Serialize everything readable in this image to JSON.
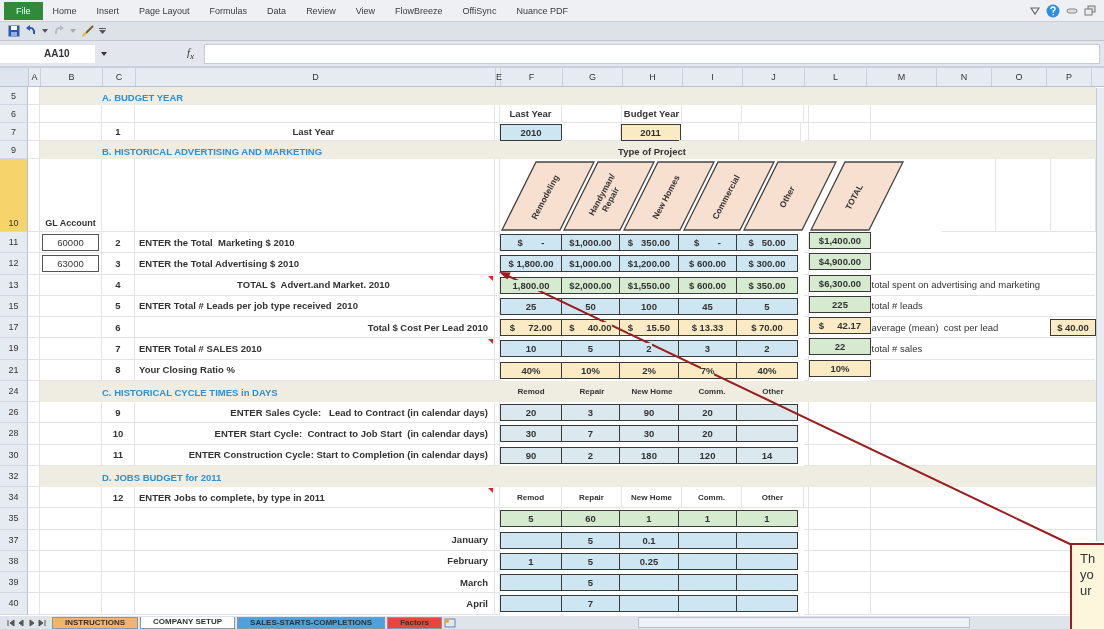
{
  "ribbon": {
    "tabs": [
      {
        "label": "File",
        "selected": true
      },
      {
        "label": "Home",
        "selected": false
      },
      {
        "label": "Insert",
        "selected": false
      },
      {
        "label": "Page Layout",
        "selected": false
      },
      {
        "label": "Formulas",
        "selected": false
      },
      {
        "label": "Data",
        "selected": false
      },
      {
        "label": "Review",
        "selected": false
      },
      {
        "label": "View",
        "selected": false
      },
      {
        "label": "FlowBreeze",
        "selected": false
      },
      {
        "label": "OffiSync",
        "selected": false
      },
      {
        "label": "Nuance PDF",
        "selected": false
      }
    ]
  },
  "formula_bar": {
    "name_box": "AA10",
    "fx": "f$_{x}$"
  },
  "columns": [
    "A",
    "B",
    "C",
    "D",
    "E",
    "F",
    "G",
    "H",
    "I",
    "J",
    "L",
    "M",
    "N",
    "O",
    "P"
  ],
  "rows": [
    {
      "num": "5",
      "kind": "section",
      "title": "A. BUDGET YEAR"
    },
    {
      "num": "6",
      "kind": "entry",
      "cols": [
        {
          "kind": "caption",
          "text": "Last Year"
        },
        {
          "kind": "blank"
        },
        {
          "kind": "caption",
          "text": "Budget Year"
        },
        {
          "kind": "blank"
        },
        {
          "kind": "blank"
        }
      ]
    },
    {
      "num": "7",
      "kind": "total",
      "step": "1",
      "label": "Last Year",
      "cols": [
        {
          "kind": "input",
          "text": "2010"
        },
        {
          "kind": "blank"
        },
        {
          "kind": "result",
          "text": "2011"
        },
        {
          "kind": "blank"
        },
        {
          "kind": "blank"
        }
      ]
    },
    {
      "num": "9",
      "kind": "section",
      "title": "B. HISTORICAL ADVERTISING  AND MARKETING",
      "caption": "Type of Project"
    },
    {
      "num": "10",
      "kind": "diagonal",
      "gl_heading": "GL Account",
      "headers": [
        {
          "lines": [
            "Remodeling"
          ]
        },
        {
          "lines": [
            "Handyman/",
            "Repair"
          ]
        },
        {
          "lines": [
            "New Homes"
          ]
        },
        {
          "lines": [
            "Commercial"
          ]
        },
        {
          "lines": [
            "Other"
          ]
        },
        {
          "lines": [
            "TOTAL"
          ]
        }
      ]
    },
    {
      "num": "11",
      "kind": "entry",
      "gl": "60000",
      "step": "2",
      "label": "ENTER the Total  Marketing $ 2010",
      "cols": [
        {
          "kind": "input",
          "text": "$       -"
        },
        {
          "kind": "input",
          "text": "$1,000.00"
        },
        {
          "kind": "input",
          "text": "$   350.00"
        },
        {
          "kind": "input",
          "text": "$       -"
        },
        {
          "kind": "input",
          "text": "$   50.00"
        }
      ],
      "total": {
        "kind": "formula",
        "text": "$1,400.00"
      }
    },
    {
      "num": "12",
      "kind": "entry",
      "gl": "63000",
      "step": "3",
      "label": "ENTER the Total Advertising $ 2010",
      "cols": [
        {
          "kind": "input",
          "text": "$ 1,800.00"
        },
        {
          "kind": "input",
          "text": "$1,000.00"
        },
        {
          "kind": "input",
          "text": "$1,200.00"
        },
        {
          "kind": "input",
          "text": "$ 600.00"
        },
        {
          "kind": "input",
          "text": "$ 300.00"
        }
      ],
      "total": {
        "kind": "formula",
        "text": "$4,900.00"
      }
    },
    {
      "num": "13",
      "kind": "total",
      "step": "4",
      "label": "TOTAL $  Advert.and Market. 2010",
      "comment": true,
      "cols": [
        {
          "kind": "formula",
          "text": "1,800.00"
        },
        {
          "kind": "formula",
          "text": "$2,000.00"
        },
        {
          "kind": "formula",
          "text": "$1,550.00"
        },
        {
          "kind": "formula",
          "text": "$ 600.00"
        },
        {
          "kind": "formula",
          "text": "$ 350.00"
        }
      ],
      "total": {
        "kind": "formula",
        "text": "$6,300.00"
      },
      "note": "total spent on advertising and marketing"
    },
    {
      "num": "15",
      "kind": "entry",
      "step": "5",
      "label": "ENTER Total # Leads per job type received  2010",
      "cols": [
        {
          "kind": "input",
          "text": "25"
        },
        {
          "kind": "input",
          "text": "50"
        },
        {
          "kind": "input",
          "text": "100"
        },
        {
          "kind": "input",
          "text": "45"
        },
        {
          "kind": "input",
          "text": "5"
        }
      ],
      "total": {
        "kind": "formula",
        "text": "225"
      },
      "note": "total # leads"
    },
    {
      "num": "17",
      "kind": "calc",
      "step": "6",
      "label": "Total $ Cost Per Lead 2010",
      "cols": [
        {
          "kind": "result",
          "text": "$     72.00"
        },
        {
          "kind": "result",
          "text": "$     40.00"
        },
        {
          "kind": "result",
          "text": "$     15.50"
        },
        {
          "kind": "result",
          "text": "$ 13.33"
        },
        {
          "kind": "result",
          "text": "$ 70.00"
        }
      ],
      "total": {
        "kind": "result",
        "text": "$     42.17"
      },
      "note": "average (mean)  cost per lead",
      "extra": {
        "kind": "result",
        "text": "$ 40.00"
      }
    },
    {
      "num": "19",
      "kind": "entry",
      "step": "7",
      "label": "ENTER Total # SALES 2010",
      "comment": true,
      "cols": [
        {
          "kind": "input",
          "text": "10"
        },
        {
          "kind": "input",
          "text": "5"
        },
        {
          "kind": "input",
          "text": "2"
        },
        {
          "kind": "input",
          "text": "3"
        },
        {
          "kind": "input",
          "text": "2"
        }
      ],
      "total": {
        "kind": "formula",
        "text": "22"
      },
      "note": "total # sales"
    },
    {
      "num": "21",
      "kind": "entry",
      "step": "8",
      "label": "Your Closing Ratio %",
      "cols": [
        {
          "kind": "result",
          "text": "40%"
        },
        {
          "kind": "result",
          "text": "10%"
        },
        {
          "kind": "result",
          "text": "2%"
        },
        {
          "kind": "result",
          "text": "7%"
        },
        {
          "kind": "result",
          "text": "40%"
        }
      ],
      "total": {
        "kind": "result",
        "text": "10%"
      }
    },
    {
      "num": "24",
      "kind": "section",
      "title": "C. HISTORICAL CYCLE TIMES in DAYS",
      "cols": [
        {
          "kind": "header",
          "text": "Remod"
        },
        {
          "kind": "header",
          "text": "Repair"
        },
        {
          "kind": "header",
          "text": "New Home"
        },
        {
          "kind": "header",
          "text": "Comm."
        },
        {
          "kind": "header",
          "text": "Other"
        }
      ]
    },
    {
      "num": "26",
      "kind": "calc",
      "step": "9",
      "label": "ENTER Sales Cycle:   Lead to Contract (in calendar days)",
      "cols": [
        {
          "kind": "cycle",
          "text": "20"
        },
        {
          "kind": "cycle",
          "text": "3"
        },
        {
          "kind": "cycle",
          "text": "90"
        },
        {
          "kind": "cycle",
          "text": "20"
        },
        {
          "kind": "cycle"
        }
      ]
    },
    {
      "num": "28",
      "kind": "calc",
      "step": "10",
      "label": "ENTER Start Cycle:  Contract to Job Start  (in calendar days)",
      "cols": [
        {
          "kind": "cycle",
          "text": "30"
        },
        {
          "kind": "cycle",
          "text": "7"
        },
        {
          "kind": "cycle",
          "text": "30"
        },
        {
          "kind": "cycle",
          "text": "20"
        },
        {
          "kind": "cycle"
        }
      ]
    },
    {
      "num": "30",
      "kind": "calc",
      "step": "11",
      "label": "ENTER Construction Cycle: Start to Completion (in calendar days)",
      "cols": [
        {
          "kind": "cycle",
          "text": "90"
        },
        {
          "kind": "cycle",
          "text": "2"
        },
        {
          "kind": "cycle",
          "text": "180"
        },
        {
          "kind": "cycle",
          "text": "120"
        },
        {
          "kind": "cycle",
          "text": "14"
        }
      ]
    },
    {
      "num": "32",
      "kind": "section",
      "title": "D. JOBS BUDGET for 2011"
    },
    {
      "num": "34",
      "kind": "entry",
      "step": "12",
      "label": "ENTER Jobs to complete, by type in 2011",
      "comment": true,
      "cols": [
        {
          "kind": "header",
          "text": "Remod"
        },
        {
          "kind": "header",
          "text": "Repair"
        },
        {
          "kind": "header",
          "text": "New Home"
        },
        {
          "kind": "header",
          "text": "Comm."
        },
        {
          "kind": "header",
          "text": "Other"
        }
      ]
    },
    {
      "num": "35",
      "kind": "entry",
      "cols": [
        {
          "kind": "formula",
          "text": "5"
        },
        {
          "kind": "formula",
          "text": "60"
        },
        {
          "kind": "formula",
          "text": "1"
        },
        {
          "kind": "formula",
          "text": "1"
        },
        {
          "kind": "formula",
          "text": "1"
        }
      ]
    },
    {
      "num": "37",
      "kind": "calc",
      "label": "January",
      "cols": [
        {
          "kind": "input"
        },
        {
          "kind": "input",
          "text": "5"
        },
        {
          "kind": "input",
          "text": "0.1"
        },
        {
          "kind": "input"
        },
        {
          "kind": "input"
        }
      ]
    },
    {
      "num": "38",
      "kind": "calc",
      "label": "February",
      "cols": [
        {
          "kind": "input",
          "text": "1"
        },
        {
          "kind": "input",
          "text": "5"
        },
        {
          "kind": "input",
          "text": "0.25"
        },
        {
          "kind": "input"
        },
        {
          "kind": "input"
        }
      ]
    },
    {
      "num": "39",
      "kind": "calc",
      "label": "March",
      "cols": [
        {
          "kind": "input"
        },
        {
          "kind": "input",
          "text": "5"
        },
        {
          "kind": "input"
        },
        {
          "kind": "input"
        },
        {
          "kind": "input"
        }
      ]
    },
    {
      "num": "40",
      "kind": "calc",
      "label": "April",
      "cols": [
        {
          "kind": "input"
        },
        {
          "kind": "input",
          "text": "7"
        },
        {
          "kind": "input"
        },
        {
          "kind": "input"
        },
        {
          "kind": "input"
        }
      ]
    }
  ],
  "sheet_tabs": [
    {
      "label": "INSTRUCTIONS",
      "selected": false,
      "color": "#f6b26b"
    },
    {
      "label": "COMPANY SETUP",
      "selected": true
    },
    {
      "label": "SALES-STARTS-COMPLETIONS",
      "selected": false,
      "color": "#4aa3df"
    },
    {
      "label": "Factors",
      "selected": false,
      "color": "#e8453c"
    }
  ],
  "callout": {
    "lines": [
      "Th",
      "yo",
      "ur"
    ]
  }
}
